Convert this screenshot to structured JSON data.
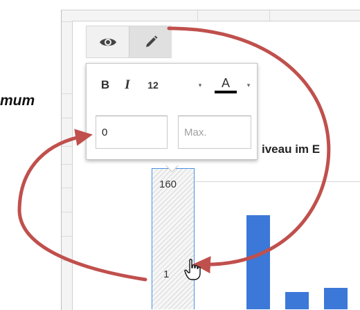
{
  "side_text": "mum",
  "toolbar": {
    "view_mode_icon": "eye-icon",
    "edit_mode_icon": "pencil-icon"
  },
  "format": {
    "bold": "B",
    "italic": "I",
    "font_size": "12",
    "dropdown_caret": "▾",
    "text_color_letter": "A",
    "text_color_swatch": "#000000"
  },
  "range": {
    "min_value": "0",
    "max_placeholder": "Max."
  },
  "chart": {
    "title_fragment": "iveau im E",
    "axis_label_top": "160",
    "axis_label_lower": "1"
  },
  "chart_data": {
    "type": "bar",
    "title": "iveau im E",
    "ylim": [
      0,
      160
    ],
    "tick_labels": [
      "160"
    ],
    "series": [
      {
        "values": [
          118,
          22,
          27
        ]
      }
    ],
    "bar_color": "#3c78d8"
  },
  "colors": {
    "annotation_arrow": "#c0504d",
    "axis_highlight": "#4a90e2"
  },
  "cursor_icon": "hand-pointer-icon"
}
